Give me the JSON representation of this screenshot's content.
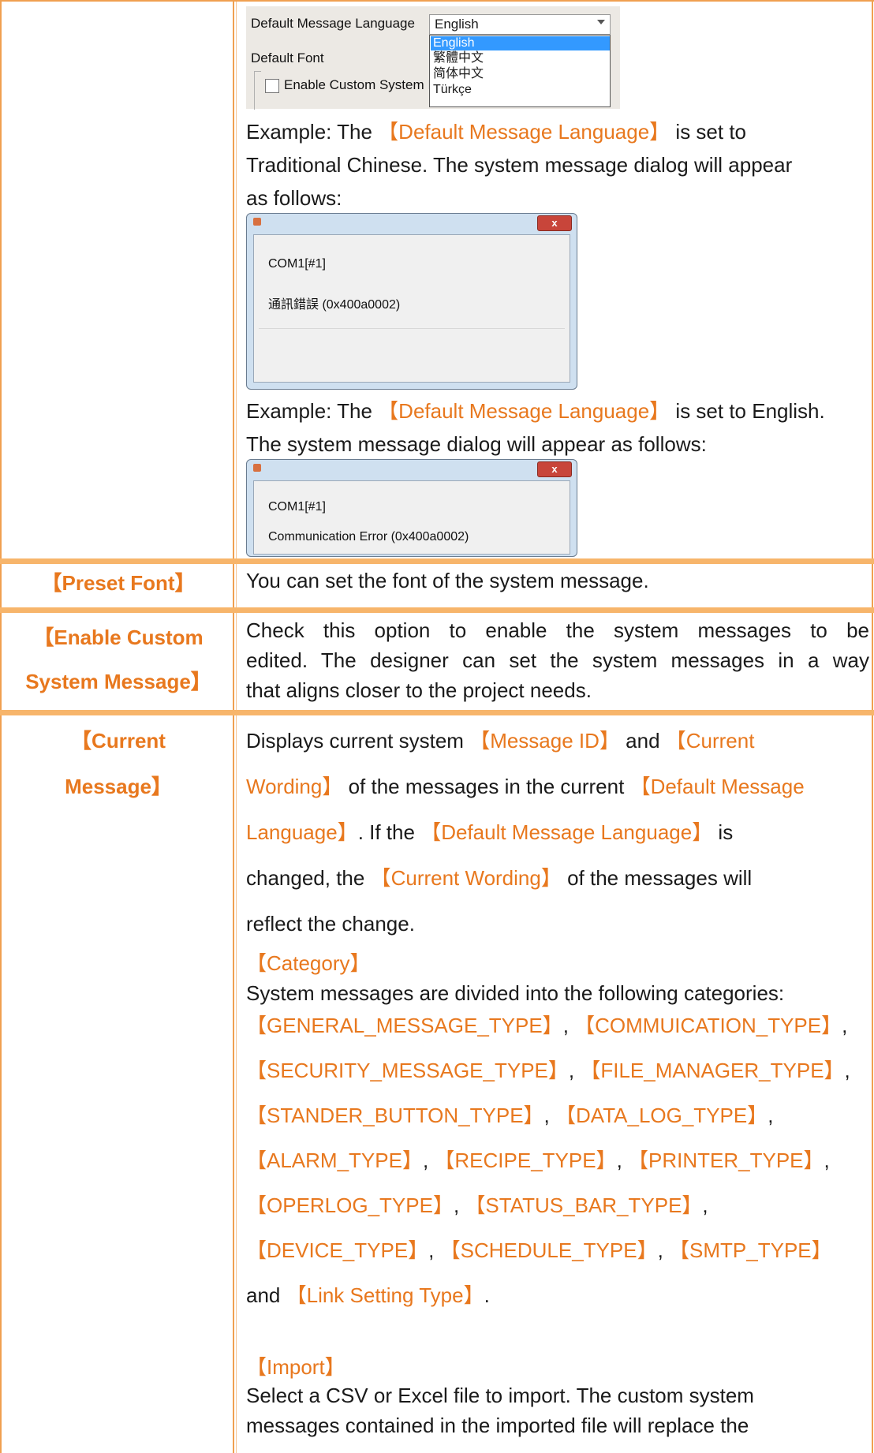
{
  "screenshot_language": {
    "default_message_language_label": "Default Message Language",
    "selected_value": "English",
    "default_font_label": "Default Font",
    "enable_custom_label": "Enable Custom System I",
    "options": [
      "English",
      "繁體中文",
      "简体中文",
      "Türkçe"
    ]
  },
  "example_traditional": {
    "prefix": "Example: The ",
    "term": "【Default Message Language】",
    "suffix": " is set to",
    "line2": "Traditional Chinese. The system message dialog will appear",
    "line3": "as follows:"
  },
  "dialog_traditional": {
    "line1": "COM1[#1]",
    "line2": "通訊錯誤 (0x400a0002)",
    "close": "x"
  },
  "example_english": {
    "prefix": "Example: The ",
    "term": "【Default Message Language】",
    "suffix": " is set to English.",
    "line2": "The system message dialog will appear as follows:"
  },
  "dialog_english": {
    "line1": "COM1[#1]",
    "line2": "Communication Error (0x400a0002)",
    "close": "x"
  },
  "rows": {
    "preset_font": {
      "label": "【Preset Font】",
      "text": "You can set the font of the system message."
    },
    "enable_custom": {
      "label_line1": "【Enable Custom",
      "label_line2": "System Message】",
      "line1": "Check this option to enable the system messages to be",
      "line2": "edited. The designer can set the system messages in a way",
      "line3": "that aligns closer to the project needs."
    },
    "current_message": {
      "label_line1": "【Current",
      "label_line2": "Message】",
      "l1_a": "Displays current system ",
      "l1_b": "【Message ID】",
      "l1_c": " and ",
      "l1_d": "【Current",
      "l2_a": "Wording】",
      "l2_b": " of the messages in the current ",
      "l2_c": "【Default Message",
      "l3_a": "Language】",
      "l3_b": ". If the ",
      "l3_c": "【Default Message Language】",
      "l3_d": " is",
      "l4_a": "changed, the ",
      "l4_b": "【Current Wording】",
      "l4_c": " of the messages will",
      "l5": "reflect the change.",
      "category_heading": "【Category】",
      "category_intro": "System messages are divided into the following categories:",
      "categories": [
        "【GENERAL_MESSAGE_TYPE】",
        "【COMMUICATION_TYPE】",
        "【SECURITY_MESSAGE_TYPE】",
        "【FILE_MANAGER_TYPE】",
        "【STANDER_BUTTON_TYPE】",
        "【DATA_LOG_TYPE】",
        "【ALARM_TYPE】",
        "【RECIPE_TYPE】",
        "【PRINTER_TYPE】",
        "【OPERLOG_TYPE】",
        "【STATUS_BAR_TYPE】",
        "【DEVICE_TYPE】",
        "【SCHEDULE_TYPE】",
        "【SMTP_TYPE】",
        "【Link Setting Type】"
      ],
      "and_word": "and ",
      "period": ".",
      "sep": ", ",
      "import_heading": "【Import】",
      "import_line1": "Select a CSV or Excel file to import. The custom system",
      "import_line2": "messages contained in the imported file will replace the"
    }
  }
}
